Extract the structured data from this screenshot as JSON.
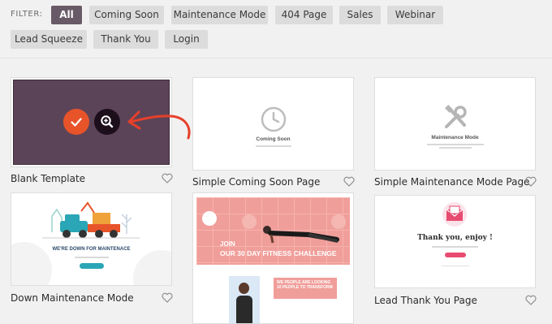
{
  "filter": {
    "label": "FILTER:",
    "chips": [
      "All",
      "Coming Soon",
      "Maintenance Mode",
      "404 Page",
      "Sales",
      "Webinar",
      "Lead Squeeze",
      "Thank You",
      "Login"
    ]
  },
  "cards": {
    "blank": {
      "title": "Blank Template"
    },
    "coming_soon": {
      "title": "Simple Coming Soon Page",
      "preview_text": "Coming Soon"
    },
    "maintenance": {
      "title": "Simple Maintenance Mode Page",
      "preview_text": "Maintenance Mode"
    },
    "down": {
      "title": "Down Maintenance Mode",
      "preview_text": "WE'RE DOWN FOR MAINTENACE"
    },
    "fitness": {
      "preview_line1": "JOIN",
      "preview_line2": "OUR 30 DAY FITNESS CHALLENGE",
      "preview_sub1": "WE PEOPLE ARE LOOKING",
      "preview_sub2": "10 PEOPLE TO TRANSFORM"
    },
    "thank_you": {
      "title": "Lead Thank You Page",
      "preview_text": "Thank you, enjoy !"
    }
  },
  "colors": {
    "active_chip": "#685a66",
    "blank_bg": "#5c4458",
    "check": "#e8542a",
    "arrow": "#e8402a",
    "teal": "#2aa6b6",
    "pink": "#e84b70"
  }
}
